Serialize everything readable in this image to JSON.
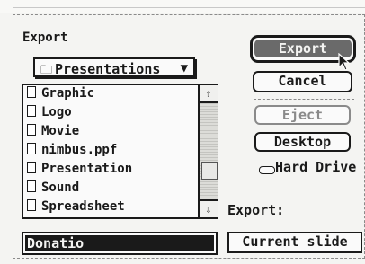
{
  "dialog": {
    "title": "Export",
    "folder_popup": {
      "selected": "Presentations",
      "icon": "folder-icon",
      "arrow": "▼"
    },
    "files": [
      "Graphic",
      "Logo",
      "Movie",
      "nimbus.ppf",
      "Presentation",
      "Sound",
      "Spreadsheet"
    ],
    "filename_value": "Donatio",
    "buttons": {
      "export": "Export",
      "cancel": "Cancel",
      "eject": "Eject",
      "desktop": "Desktop"
    },
    "volume": {
      "label": "Hard Drive",
      "icon": "hard-drive-icon"
    },
    "export_label": "Export:",
    "export_option": "Current slide",
    "scroll_arrows": {
      "up": "⇧",
      "down": "⇩"
    }
  }
}
